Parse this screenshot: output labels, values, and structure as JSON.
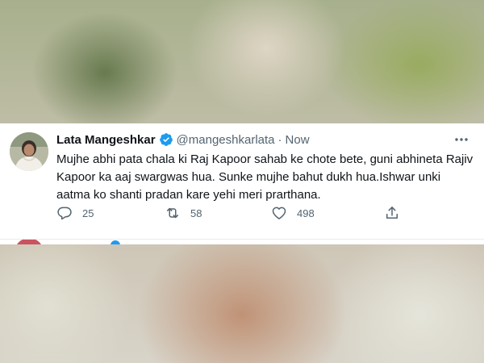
{
  "tweet": {
    "author_name": "Lata Mangeshkar",
    "handle": "@mangeshkarlata",
    "separator": "·",
    "time": "Now",
    "text": "Mujhe abhi pata chala ki Raj Kapoor sahab ke chote bete, guni abhineta Rajiv Kapoor ka aaj swargwas hua. Sunke mujhe bahut dukh hua.Ishwar unki aatma ko shanti pradan kare yehi meri prarthana.",
    "replies": "25",
    "retweets": "58",
    "likes": "498",
    "icons": {
      "verified": "verified-badge-icon",
      "more": "more-options-icon",
      "reply": "reply-icon",
      "retweet": "retweet-icon",
      "like": "heart-icon",
      "share": "share-icon"
    }
  },
  "colors": {
    "text_primary": "#0f1419",
    "text_secondary": "#536471",
    "verified_blue": "#1d9bf0"
  }
}
